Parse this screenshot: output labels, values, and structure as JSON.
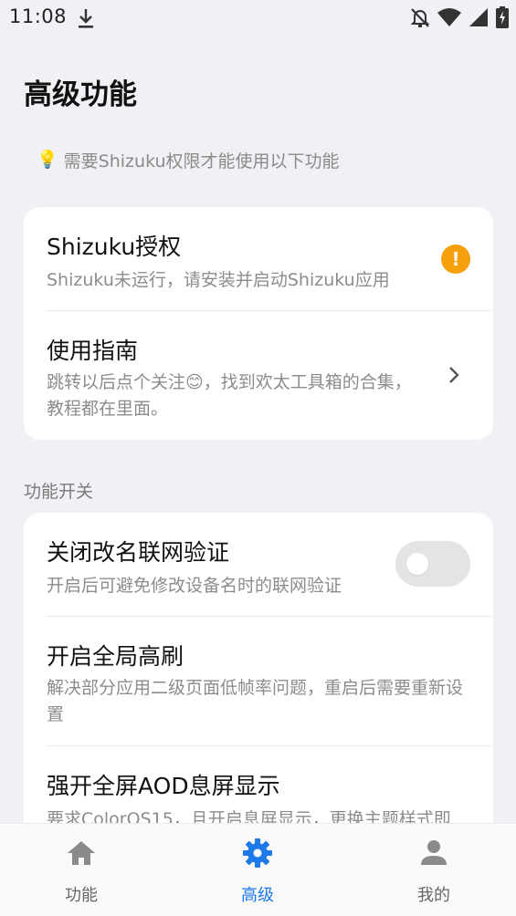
{
  "status_bar": {
    "time": "11:08",
    "icons": [
      "download-icon",
      "bell-off-icon",
      "wifi-icon",
      "signal-icon",
      "battery-charging-icon"
    ]
  },
  "page": {
    "title": "高级功能"
  },
  "hint": {
    "icon": "lightbulb-icon",
    "text": "需要Shizuku权限才能使用以下功能"
  },
  "cards": {
    "shizuku": {
      "title": "Shizuku授权",
      "desc": "Shizuku未运行，请安装并启动Shizuku应用",
      "badge": "!",
      "badge_color": "#f5a00e"
    },
    "guide": {
      "title": "使用指南",
      "desc": "跳转以后点个关注😊，找到欢太工具箱的合集，教程都在里面。"
    }
  },
  "section_label": "功能开关",
  "switches": [
    {
      "title": "关闭改名联网验证",
      "desc": "开启后可避免修改设备名时的联网验证",
      "enabled": false
    },
    {
      "title": "开启全局高刷",
      "desc": "解决部分应用二级页面低帧率问题，重启后需要重新设置"
    },
    {
      "title": "强开全屏AOD息屏显示",
      "desc": "要求ColorOS15，且开启息屏显示，更换主题样式即"
    }
  ],
  "nav": {
    "items": [
      {
        "label": "功能",
        "icon": "home-icon"
      },
      {
        "label": "高级",
        "icon": "gear-icon"
      },
      {
        "label": "我的",
        "icon": "person-icon"
      }
    ],
    "active_index": 1,
    "active_color": "#1e7ae8",
    "inactive_color": "#8a8a8a"
  }
}
